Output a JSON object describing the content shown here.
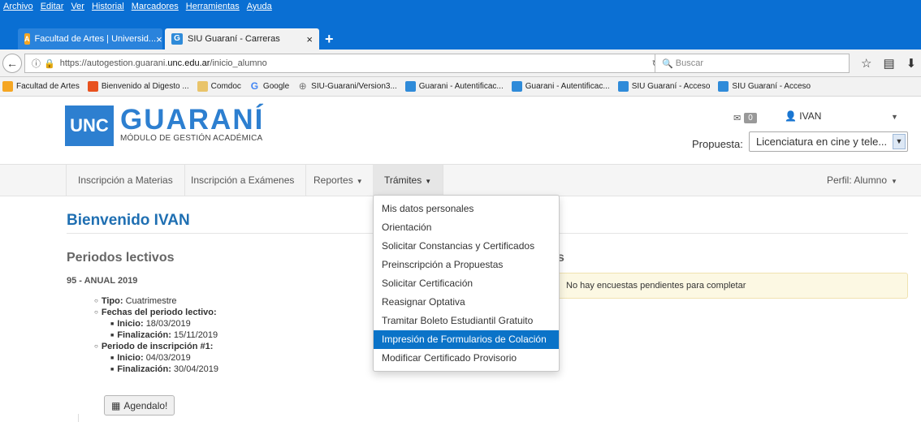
{
  "browser": {
    "menu": [
      "Archivo",
      "Editar",
      "Ver",
      "Historial",
      "Marcadores",
      "Herramientas",
      "Ayuda"
    ],
    "tabs": [
      {
        "title": "Facultad de Artes | Universid...",
        "close": "×"
      },
      {
        "title": "SIU Guaraní - Carreras",
        "close": "×"
      }
    ],
    "new_tab": "+",
    "url_prefix": "https://autogestion.guarani.",
    "url_domain": "unc.edu.ar",
    "url_suffix": "/inicio_alumno",
    "search_placeholder": "Buscar",
    "bookmarks": [
      {
        "label": "Facultad de Artes",
        "icon": "unc-icon"
      },
      {
        "label": "Bienvenido al Digesto ...",
        "icon": "digesto-icon"
      },
      {
        "label": "Comdoc",
        "icon": "folder-icon"
      },
      {
        "label": "Google",
        "icon": "google-icon"
      },
      {
        "label": "SIU-Guarani/Version3...",
        "icon": "globe-icon"
      },
      {
        "label": "Guarani - Autentificac...",
        "icon": "guarani-icon"
      },
      {
        "label": "Guarani - Autentificac...",
        "icon": "guarani-icon"
      },
      {
        "label": "SIU Guaraní - Acceso",
        "icon": "guarani-icon"
      },
      {
        "label": "SIU Guaraní - Acceso",
        "icon": "guarani-icon"
      }
    ]
  },
  "header": {
    "logo_badge": "UNC",
    "logo_name": "GUARANÍ",
    "logo_sub": "MÓDULO DE GESTIÓN ACADÉMICA",
    "messages_count": "0",
    "user_name": "IVAN",
    "propuesta_label": "Propuesta:",
    "propuesta_value": "Licenciatura en cine y tele..."
  },
  "nav": {
    "items": [
      {
        "label": "Inscripción a Materias"
      },
      {
        "label": "Inscripción a Exámenes"
      },
      {
        "label": "Reportes"
      },
      {
        "label": "Trámites"
      }
    ],
    "perfil": "Perfil: Alumno"
  },
  "tramites_menu": [
    "Mis datos personales",
    "Orientación",
    "Solicitar Constancias y Certificados",
    "Preinscripción a Propuestas",
    "Solicitar Certificación",
    "Reasignar Optativa",
    "Tramitar Boleto Estudiantil Gratuito",
    "Impresión de Formularios de Colación",
    "Modificar Certificado Provisorio"
  ],
  "main": {
    "welcome": "Bienvenido IVAN",
    "periods_title": "Periodos lectivos",
    "enc_title_tail": "s",
    "year": "95 - ANUAL 2019",
    "encuestas_msg": "No hay encuestas pendientes para completar",
    "tipo_label": "Tipo:",
    "tipo_value": "Cuatrimestre",
    "fechas_label": "Fechas del periodo lectivo:",
    "inicio_label": "Inicio:",
    "inicio_value": "18/03/2019",
    "fin_label": "Finalización:",
    "fin_value": "15/11/2019",
    "insc_label": "Periodo de inscripción #1:",
    "insc_inicio_value": "04/03/2019",
    "insc_fin_value": "30/04/2019",
    "agenda_label": "Agendalo!"
  }
}
